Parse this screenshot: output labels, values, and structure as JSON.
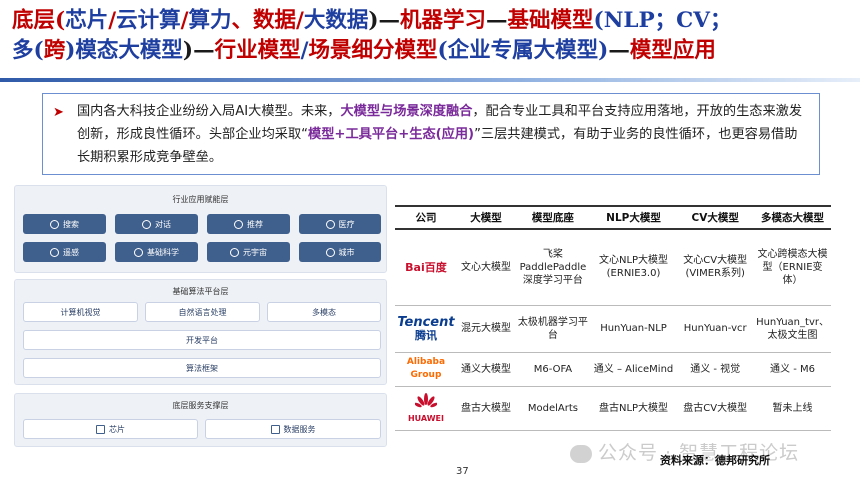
{
  "title": {
    "line1_a": "底层(",
    "line1_b": "芯片",
    "line1_c": "/",
    "line1_d": "云计算",
    "line1_e": "/",
    "line1_f": "算力",
    "line1_g": "、数据/",
    "line1_h": "大数据",
    "line1_i": ")—",
    "line1_j": "机器学习",
    "line1_k": "—",
    "line1_l": "基础模型",
    "line1_m": "(NLP；CV；",
    "line2_a": "多(",
    "line2_b": "跨",
    "line2_c": ")模态大模型",
    "line2_d": ")—",
    "line2_e": "行业模型",
    "line2_f": "/",
    "line2_g": "场景细分模型",
    "line2_h": "(企业专属大模型)",
    "line2_i": "—",
    "line2_j": "模型应用"
  },
  "bullet": {
    "seg1": "国内各大科技企业纷纷入局AI大模型。未来，",
    "seg2": "大模型与场景深度融合",
    "seg3": "，配合专业工具和平台支持应用落地，开放的生态来激发创新，形成良性循环。头部企业均采取“",
    "seg4": "模型+工具平台+生态(应用)",
    "seg5": "”三层共建模式，有助于业务的良性循环，也更容易借助长期积累形成竞争壁垒。"
  },
  "diagram": {
    "layer1_title": "行业应用赋能层",
    "layer1_items": [
      "搜索",
      "对话",
      "推荐",
      "医疗",
      "遥感",
      "基础科学",
      "元宇宙",
      "城市"
    ],
    "layer2_title": "基础算法平台层",
    "layer2_row1": [
      "计算机视觉",
      "自然语言处理",
      "多模态"
    ],
    "layer2_row2": "开发平台",
    "layer2_row3": "算法框架",
    "layer3_title": "底层服务支撑层",
    "layer3_items": [
      "芯片",
      "数据服务"
    ]
  },
  "table": {
    "headers": [
      "公司",
      "大模型",
      "模型底座",
      "NLP大模型",
      "CV大模型",
      "多模态大模型"
    ],
    "rows": [
      {
        "company": "百度",
        "logo_text": "Bai百度",
        "model": "文心大模型",
        "base": "飞桨 PaddlePaddle 深度学习平台",
        "nlp": "文心NLP大模型 (ERNIE3.0)",
        "cv": "文心CV大模型 (VIMER系列)",
        "mm": "文心跨模态大模型（ERNIE变体）"
      },
      {
        "company": "腾讯",
        "logo_text": "Tencent",
        "logo_sub": "腾讯",
        "model": "混元大模型",
        "base": "太极机器学习平台",
        "nlp": "HunYuan-NLP",
        "cv": "HunYuan-vcr",
        "mm": "HunYuan_tvr、太极文生图"
      },
      {
        "company": "阿里巴巴",
        "logo_text": "Alibaba Group",
        "model": "通义大模型",
        "base": "M6-OFA",
        "nlp": "通义 – AliceMind",
        "cv": "通义 - 视觉",
        "mm": "通义 - M6"
      },
      {
        "company": "华为",
        "logo_text": "HUAWEI",
        "model": "盘古大模型",
        "base": "ModelArts",
        "nlp": "盘古NLP大模型",
        "cv": "盘古CV大模型",
        "mm": "暂未上线"
      }
    ]
  },
  "footer": {
    "page_number": "37",
    "source": "资料来源：德邦研究所",
    "watermark": "公众号 · 智慧工程论坛"
  }
}
